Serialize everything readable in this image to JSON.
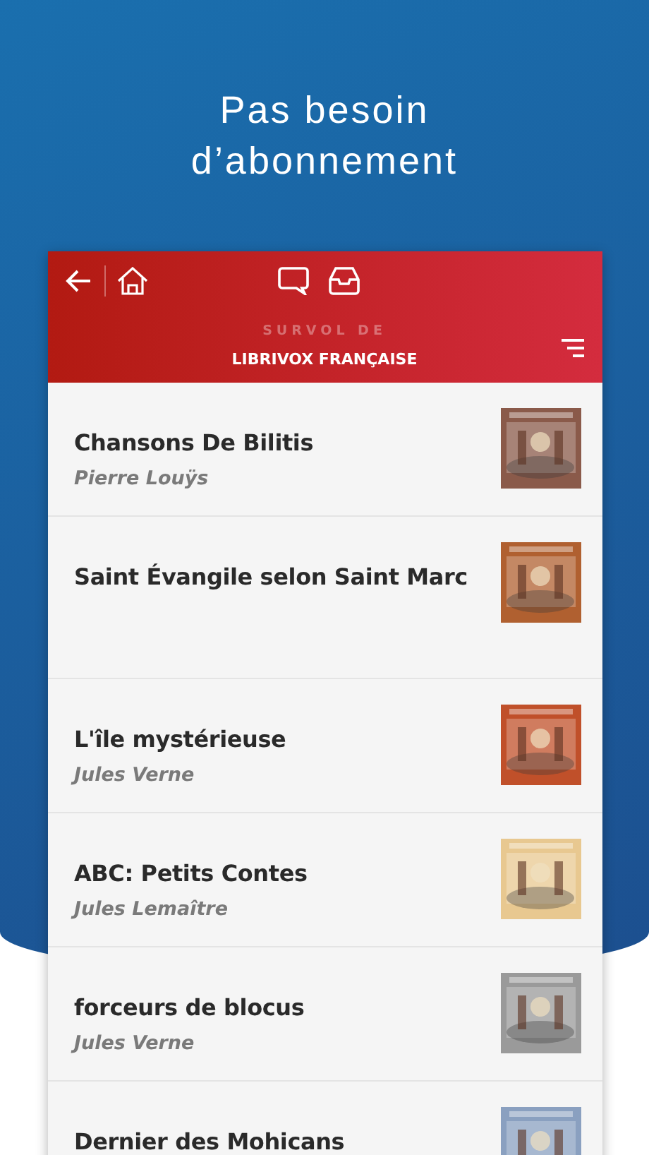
{
  "headline": [
    "Pas besoin",
    "d’abonnement"
  ],
  "header": {
    "subtitle": "SURVOL DE",
    "title": "LIBRIVOX FRANÇAISE"
  },
  "books": [
    {
      "title": "Chansons De Bilitis",
      "author": "Pierre Louÿs"
    },
    {
      "title": "Saint Évangile selon Saint Marc"
    },
    {
      "title": "L'île mystérieuse",
      "author": "Jules Verne"
    },
    {
      "title": "ABC: Petits Contes",
      "author": "Jules Lemaître"
    },
    {
      "title": "forceurs de blocus",
      "author": "Jules Verne"
    },
    {
      "title": "Dernier des Mohicans"
    }
  ]
}
